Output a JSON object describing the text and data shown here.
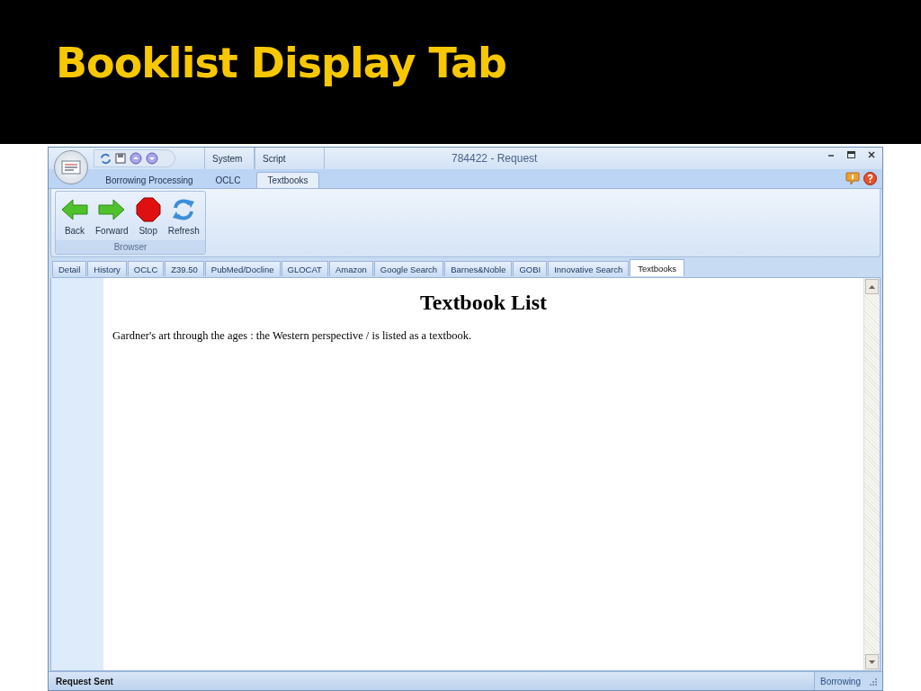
{
  "slide_title": "Booklist Display Tab",
  "window": {
    "title": "784422 - Request"
  },
  "ribbon": {
    "upper_tabs": [
      "System",
      "Script"
    ],
    "tabs": [
      {
        "label": "Borrowing Processing",
        "selected": false
      },
      {
        "label": "OCLC",
        "selected": false
      },
      {
        "label": "Textbooks",
        "selected": true
      }
    ],
    "groups": [
      {
        "label": "Browser",
        "buttons": [
          {
            "label": "Back",
            "kind": "back"
          },
          {
            "label": "Forward",
            "kind": "forward"
          },
          {
            "label": "Stop",
            "kind": "stop"
          },
          {
            "label": "Refresh",
            "kind": "refresh"
          }
        ]
      }
    ]
  },
  "tabs": [
    {
      "label": "Detail",
      "selected": false
    },
    {
      "label": "History",
      "selected": false
    },
    {
      "label": "OCLC",
      "selected": false
    },
    {
      "label": "Z39.50",
      "selected": false
    },
    {
      "label": "PubMed/Docline",
      "selected": false
    },
    {
      "label": "GLOCAT",
      "selected": false
    },
    {
      "label": "Amazon",
      "selected": false
    },
    {
      "label": "Google Search",
      "selected": false
    },
    {
      "label": "Barnes&Noble",
      "selected": false
    },
    {
      "label": "GOBI",
      "selected": false
    },
    {
      "label": "Innovative Search",
      "selected": false
    },
    {
      "label": "Textbooks",
      "selected": true
    }
  ],
  "page": {
    "heading": "Textbook List",
    "text": "Gardner's art through the ages : the Western perspective / is listed as a textbook."
  },
  "status_bar": {
    "message": "Request Sent",
    "panel": "Borrowing"
  }
}
